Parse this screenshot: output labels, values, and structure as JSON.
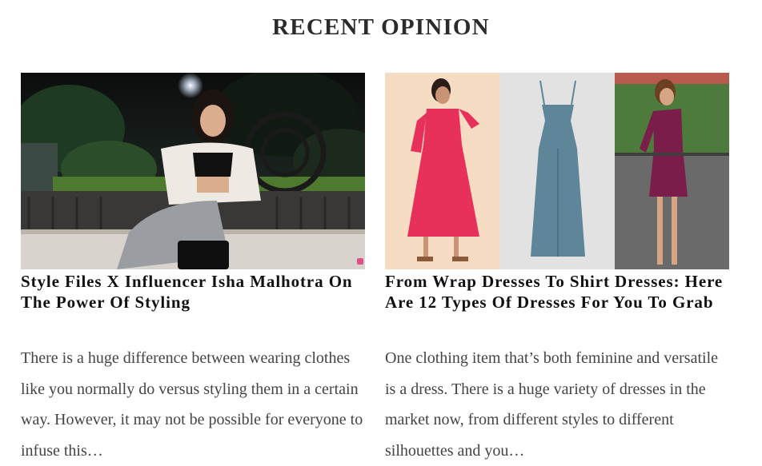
{
  "section": {
    "title": "RECENT OPINION"
  },
  "articles": [
    {
      "title": "Style Files X Influencer Isha Malhotra On The Power Of Styling",
      "excerpt": "There is a huge difference between wearing clothes like you normally do versus styling them in a certain way. However, it may not be possible for everyone to infuse this…",
      "image_alt": "Isha Malhotra seated outdoors at night in white cardigan and black top"
    },
    {
      "title": "From Wrap Dresses To Shirt Dresses: Here Are 12 Types Of Dresses For You To Grab",
      "excerpt": "One clothing item that’s both feminine and versatile is a dress. There is a huge variety of dresses in the market now, from different styles to different silhouettes and you…",
      "image_alt": "Collage of pink tiered dress, blue slip dress and plum one-shoulder dress"
    }
  ],
  "colors": {
    "title": "#2b2b2b",
    "headline": "#111111",
    "body": "#444444"
  }
}
